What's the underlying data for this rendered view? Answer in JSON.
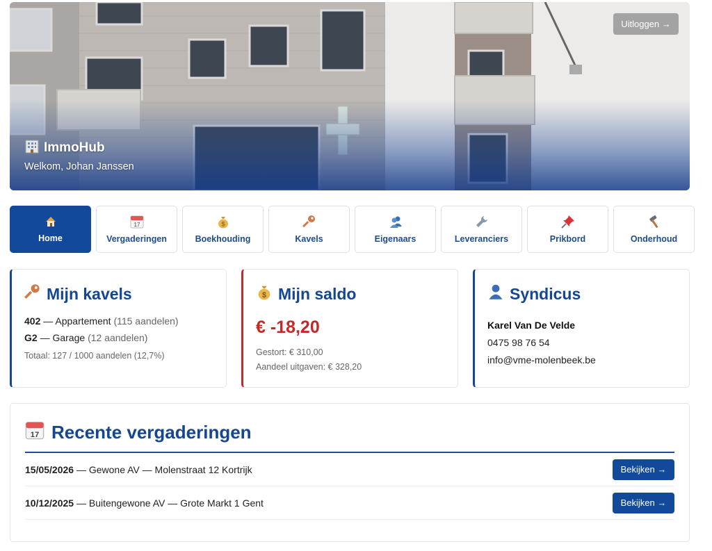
{
  "hero": {
    "brand": "ImmoHub",
    "welcome": "Welkom, Johan Janssen",
    "logout_label": "Uitloggen →"
  },
  "nav": {
    "items": [
      {
        "label": "Home",
        "icon": "house-icon",
        "active": true
      },
      {
        "label": "Vergaderingen",
        "icon": "calendar-icon",
        "active": false
      },
      {
        "label": "Boekhouding",
        "icon": "money-bag-icon",
        "active": false
      },
      {
        "label": "Kavels",
        "icon": "key-icon",
        "active": false
      },
      {
        "label": "Eigenaars",
        "icon": "people-icon",
        "active": false
      },
      {
        "label": "Leveranciers",
        "icon": "wrench-icon",
        "active": false
      },
      {
        "label": "Prikbord",
        "icon": "pushpin-icon",
        "active": false
      },
      {
        "label": "Onderhoud",
        "icon": "hammer-icon",
        "active": false
      }
    ]
  },
  "kavels": {
    "title": "Mijn kavels",
    "items": [
      {
        "id": "402",
        "type": "Appartement",
        "shares": "(115 aandelen)"
      },
      {
        "id": "G2",
        "type": "Garage",
        "shares": "(12 aandelen)"
      }
    ],
    "total": "Totaal: 127 / 1000 aandelen (12,7%)"
  },
  "saldo": {
    "title": "Mijn saldo",
    "amount": "€ -18,20",
    "deposited": "Gestort: € 310,00",
    "expenses": "Aandeel uitgaven: € 328,20"
  },
  "syndicus": {
    "title": "Syndicus",
    "name": "Karel Van De Velde",
    "phone": "0475 98 76 54",
    "email": "info@vme-molenbeek.be"
  },
  "meetings": {
    "title": "Recente vergaderingen",
    "rows": [
      {
        "date": "15/05/2026",
        "desc": "Gewone AV — Molenstraat 12 Kortrijk",
        "button": "Bekijken →"
      },
      {
        "date": "10/12/2025",
        "desc": "Buitengewone AV — Grote Markt 1 Gent",
        "button": "Bekijken →"
      }
    ]
  },
  "colors": {
    "primary": "#12499a",
    "negative": "#c62828"
  }
}
